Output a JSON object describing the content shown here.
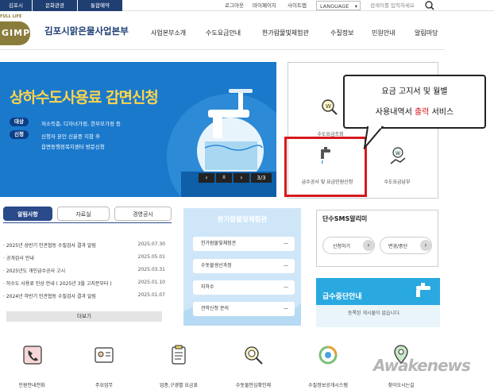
{
  "topbar": {
    "tabs": [
      "김포시",
      "문화관광",
      "통합예약"
    ],
    "links": [
      "로그아웃",
      "마이페이지",
      "사이트맵"
    ],
    "language": "LANGUAGE",
    "search_placeholder": "검색어를 입력하세요"
  },
  "header": {
    "logo_small": "FULL LIFE",
    "logo_mark": "GIMPO",
    "org_name": "김포시맑은물사업본부",
    "nav": [
      "사업본부소개",
      "수도요금안내",
      "한가람물빛체험관",
      "수질정보",
      "민원안내",
      "알림마당"
    ]
  },
  "banner": {
    "title": "상하수도사용료 감면신청",
    "target_label": "대상",
    "target_text": "저소득층, 디자녀가정, 한부모가정 등",
    "apply_label": "신청",
    "apply_text1": "신청자 본인 신분증 지참 후",
    "apply_text2": "읍면동행정복지센터 방문신청",
    "prev": "‹",
    "pause": "II",
    "next": "›",
    "page": "3/3"
  },
  "services": {
    "items": [
      "수도요금조회",
      "급수공사 및 요금민원신청",
      "수도요금납부"
    ],
    "callout_line1": "요금 고지서 및 월별",
    "callout_line2a": "사용내역서",
    "callout_line2b": "출력",
    "callout_line2c": "서비스"
  },
  "news": {
    "tabs": [
      "알림사항",
      "자료실",
      "경영공시"
    ],
    "rows": [
      {
        "title": "2025년 상반기 민관협동 수질검사 결과 알림",
        "date": "2025.07.30"
      },
      {
        "title": "공개감사 안내",
        "date": "2025.05.01"
      },
      {
        "title": "2025년도 개인급수공사 고시",
        "date": "2025.03.31"
      },
      {
        "title": "하수도 사용료 인상 안내 ( 2025년 3월 고지분부터 )",
        "date": "2025.01.10"
      },
      {
        "title": "2024년 하반기 민관협동 수질검사 결과 알림",
        "date": "2025.01.07"
      }
    ],
    "more": "더보기"
  },
  "midpanel": {
    "title": "한가람물빛체험관",
    "rows": [
      "한가람물빛체험관",
      "수돗물생산과정",
      "지하수",
      "견학신청 문의"
    ],
    "dash": "—"
  },
  "sms": {
    "title": "단수SMS알리미",
    "btn1": "신청하기",
    "btn2": "변경/중단",
    "arrow": "›"
  },
  "outage": {
    "title": "급수중단안내",
    "text": "등록된 게시물이 없습니다."
  },
  "bottom": {
    "items": [
      "민원안내전화",
      "주요업무",
      "업종,구경별 요금표",
      "수돗물안심확인제",
      "수질정보공개시스템",
      "찾아오시는길"
    ]
  },
  "watermark": "Awakenews",
  "colors": {
    "navy": "#1f3f73",
    "banner": "#1976c8",
    "highlight": "#d7191c",
    "accent_red": "#d7191c",
    "tab_active": "#2a4a8a"
  }
}
